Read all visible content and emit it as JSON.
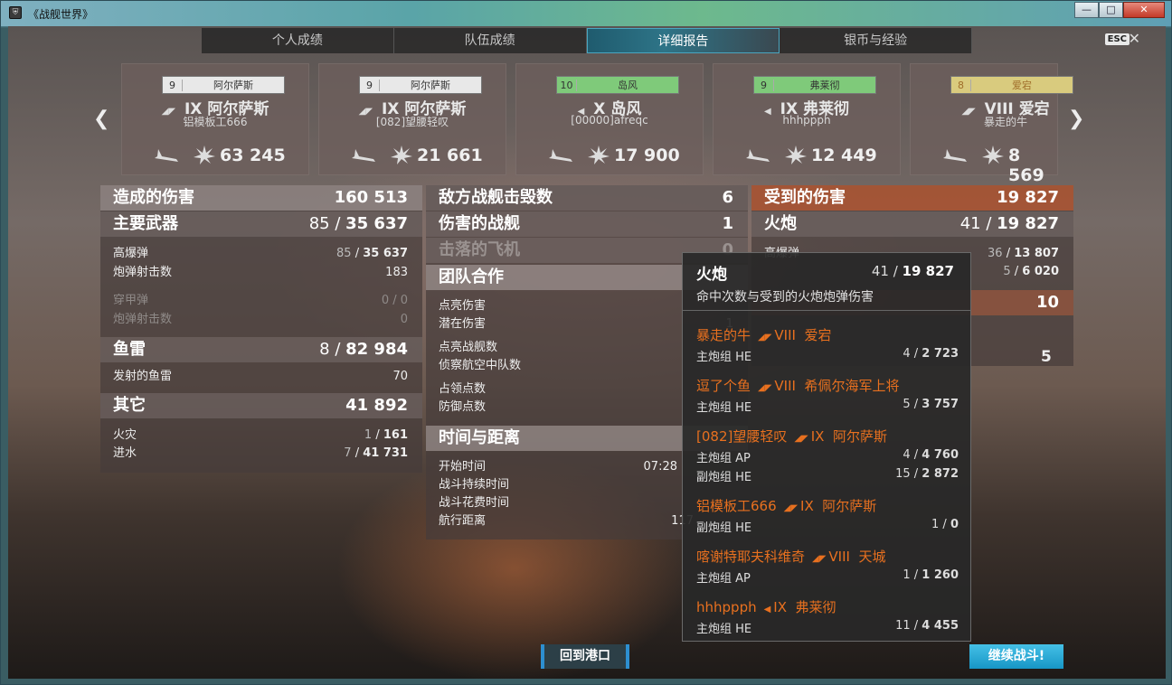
{
  "window": {
    "title": "《战舰世界》",
    "min": "—",
    "max": "□",
    "close": "✕"
  },
  "tabs": [
    "个人成绩",
    "队伍成绩",
    "详细报告",
    "银币与经验"
  ],
  "esc": "ESC",
  "cards": [
    {
      "tier": "9",
      "ship_short": "阿尔萨斯",
      "roman": "IX",
      "ship": "阿尔萨斯",
      "player": "铝模板工666",
      "damage": "63 245",
      "style": "plain"
    },
    {
      "tier": "9",
      "ship_short": "阿尔萨斯",
      "roman": "IX",
      "ship": "阿尔萨斯",
      "player": "[082]望腰轻叹",
      "damage": "21 661",
      "style": "plain"
    },
    {
      "tier": "10",
      "ship_short": "岛风",
      "roman": "X",
      "ship": "岛风",
      "player": "[00000]afreqc",
      "damage": "17 900",
      "style": "green"
    },
    {
      "tier": "9",
      "ship_short": "弗莱彻",
      "roman": "IX",
      "ship": "弗莱彻",
      "player": "hhhppph",
      "damage": "12 449",
      "style": "green"
    },
    {
      "tier": "8",
      "ship_short": "爱宕",
      "roman": "VIII",
      "ship": "爱宕",
      "player": "暴走的牛",
      "damage": "8 569",
      "style": "gold"
    }
  ],
  "left": {
    "title": "造成的伤害",
    "title_v": "160 513",
    "main_weapon": "主要武器",
    "main_weapon_a": "85",
    "main_weapon_b": "35 637",
    "he": "高爆弹",
    "he_a": "85",
    "he_b": "35 637",
    "he_shots": "炮弹射击数",
    "he_shots_v": "183",
    "ap": "穿甲弹",
    "ap_v": "0 / 0",
    "ap_shots": "炮弹射击数",
    "ap_shots_v": "0",
    "torp": "鱼雷",
    "torp_a": "8",
    "torp_b": "82 984",
    "torp_fired": "发射的鱼雷",
    "torp_fired_v": "70",
    "other": "其它",
    "other_v": "41 892",
    "fire": "火灾",
    "fire_a": "1",
    "fire_b": "161",
    "flood": "进水",
    "flood_a": "7",
    "flood_b": "41 731"
  },
  "middle": {
    "kills": "敌方战舰击毁数",
    "kills_v": "6",
    "damaged": "伤害的战舰",
    "damaged_v": "1",
    "planes": "击落的飞机",
    "planes_v": "0",
    "team": "团队合作",
    "spot_dmg": "点亮伤害",
    "potential": "潜在伤害",
    "potential_v": "1",
    "spotted": "点亮战舰数",
    "spotted_sq": "侦察航空中队数",
    "capture": "占领点数",
    "defend": "防御点数",
    "time": "时间与距离",
    "start": "开始时间",
    "start_v": "07:28",
    "duration": "战斗持续时间",
    "spent": "战斗花费时间",
    "distance": "航行距离",
    "distance_v": "117"
  },
  "right": {
    "received": "受到的伤害",
    "received_v": "19 827",
    "guns": "火炮",
    "guns_a": "41",
    "guns_b": "19 827",
    "row1": "高爆弹",
    "row1_a": "36",
    "row1_b": "13 807",
    "row2_a": "5",
    "row2_b": "6 020",
    "hdr3_v": "10",
    "stray": "5"
  },
  "tooltip": {
    "title": "火炮",
    "val_a": "41",
    "val_b": "19 827",
    "desc": "命中次数与受到的火炮炮弹伤害",
    "entries": [
      {
        "player": "暴走的牛",
        "roman": "VIII",
        "ship": "爱宕",
        "lines": [
          {
            "label": "主炮组 HE",
            "a": "4",
            "b": "2 723"
          }
        ]
      },
      {
        "player": "逗了个鱼",
        "roman": "VIII",
        "ship": "希佩尔海军上将",
        "lines": [
          {
            "label": "主炮组 HE",
            "a": "5",
            "b": "3 757"
          }
        ]
      },
      {
        "player": "[082]望腰轻叹",
        "roman": "IX",
        "ship": "阿尔萨斯",
        "lines": [
          {
            "label": "主炮组 AP",
            "a": "4",
            "b": "4 760"
          },
          {
            "label": "副炮组 HE",
            "a": "15",
            "b": "2 872"
          }
        ]
      },
      {
        "player": "铝模板工666",
        "roman": "IX",
        "ship": "阿尔萨斯",
        "lines": [
          {
            "label": "副炮组 HE",
            "a": "1",
            "b": "0"
          }
        ]
      },
      {
        "player": "喀谢特耶夫科维奇",
        "roman": "VIII",
        "ship": "天城",
        "lines": [
          {
            "label": "主炮组 AP",
            "a": "1",
            "b": "1 260"
          }
        ]
      },
      {
        "player": "hhhppph",
        "roman": "IX",
        "ship": "弗莱彻",
        "lines": [
          {
            "label": "主炮组 HE",
            "a": "11",
            "b": "4 455"
          }
        ]
      }
    ]
  },
  "buttons": {
    "port": "回到港口",
    "continue": "继续战斗!"
  }
}
